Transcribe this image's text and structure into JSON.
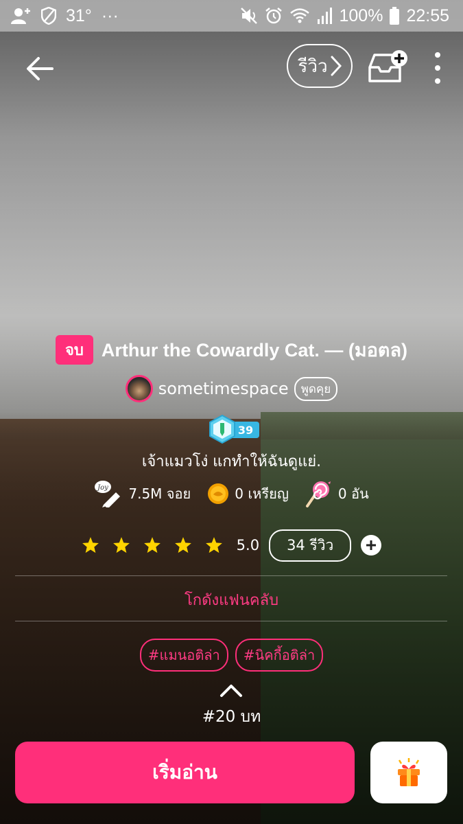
{
  "status_bar": {
    "temperature": "31°",
    "more": "···",
    "battery": "100%",
    "time": "22:55"
  },
  "toolbar": {
    "review_label": "รีวิว"
  },
  "story": {
    "status_badge": "จบ",
    "title": "Arthur the Cowardly Cat. — (มอตล)",
    "author": "sometimespace",
    "chat_label": "พูดคุย",
    "level": "39",
    "tagline": "เจ้าแมวโง่ แกทำให้ฉันดูแย่."
  },
  "stats": {
    "joy": "7.5M จอย",
    "joy_icon_text": "Joy",
    "coins": "0 เหรียญ",
    "candies": "0 อัน"
  },
  "rating": {
    "stars_filled": 5,
    "value": "5.0",
    "reviews": "34 รีวิว"
  },
  "fanclub_label": "โกดังแฟนคลับ",
  "tags": [
    "#แมนอติล่า",
    "#นิคกี้อติล่า"
  ],
  "chapters": "#20 บท",
  "start_label": "เริ่มอ่าน",
  "colors": {
    "accent": "#ff2f7a",
    "star": "#ffd400",
    "level_badge": "#38b7e3"
  }
}
